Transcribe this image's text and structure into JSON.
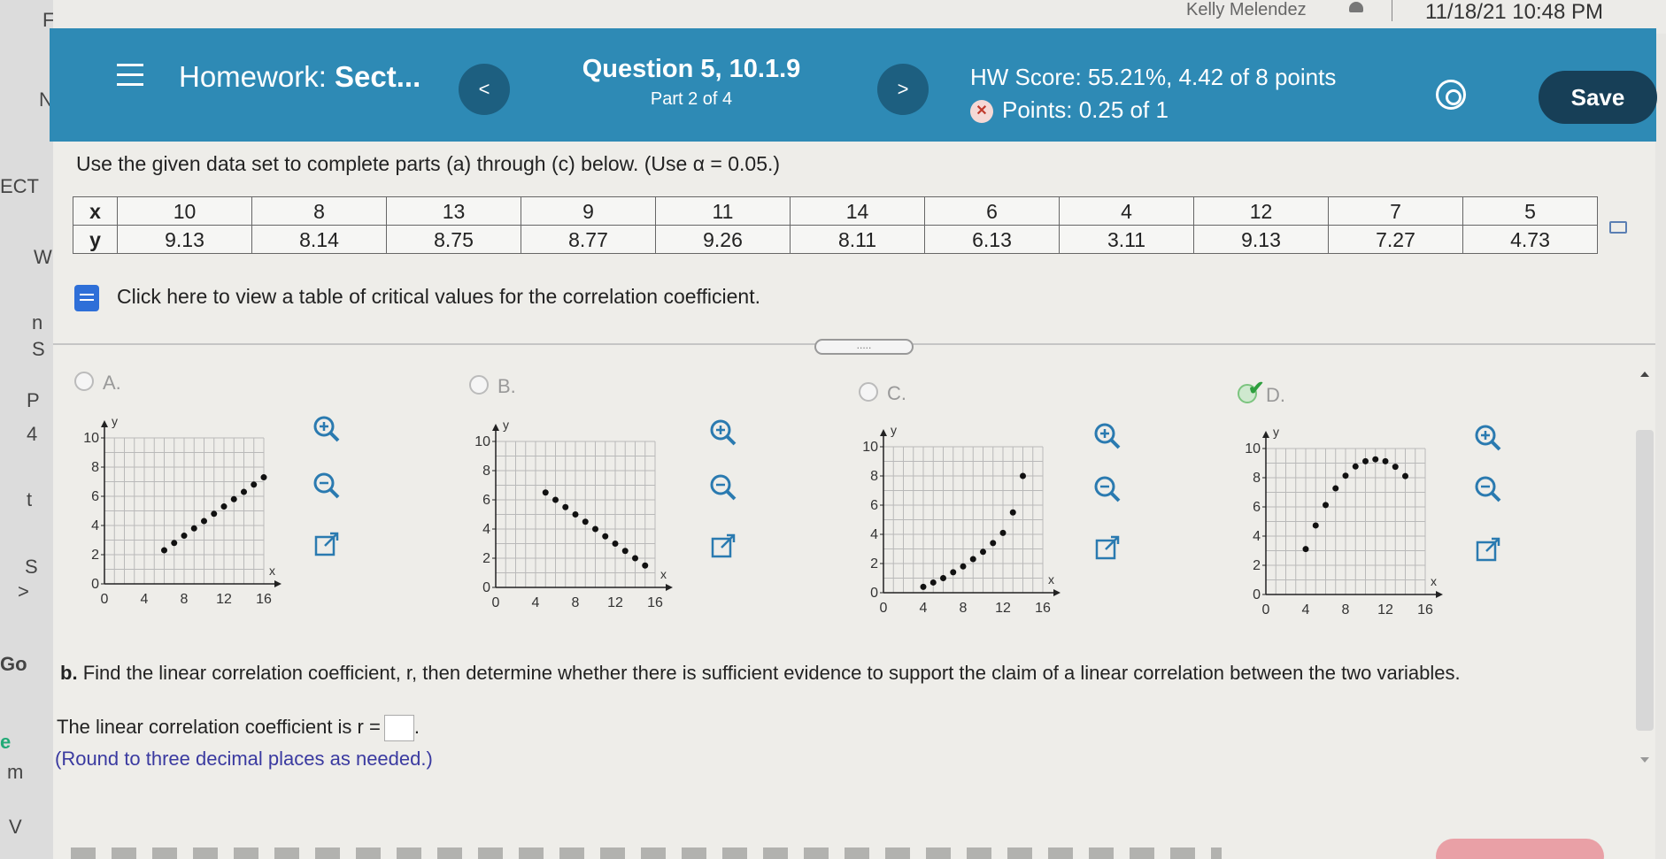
{
  "status_bar": {
    "user": "Kelly Melendez",
    "datetime": "11/18/21 10:48 PM"
  },
  "left_fragments": [
    "F",
    "N",
    "ECT",
    "W",
    "n",
    "S",
    "P",
    "4",
    "t",
    "S",
    ">",
    "Go",
    "e",
    "m",
    "V"
  ],
  "header": {
    "title_prefix": "Homework:",
    "title_section": "Sect...",
    "question": "Question 5, 10.1.9",
    "part": "Part 2 of 4",
    "hw_score": "HW Score: 55.21%, 4.42 of 8 points",
    "points": "Points: 0.25 of 1",
    "save_label": "Save",
    "prev_icon": "<",
    "next_icon": ">"
  },
  "instructions": "Use the given data set to complete parts (a) through (c) below. (Use α = 0.05.)",
  "data_table": {
    "x_label": "x",
    "y_label": "y",
    "x": [
      "10",
      "8",
      "13",
      "9",
      "11",
      "14",
      "6",
      "4",
      "12",
      "7",
      "5"
    ],
    "y": [
      "9.13",
      "8.14",
      "8.75",
      "8.77",
      "9.26",
      "8.11",
      "6.13",
      "3.11",
      "9.13",
      "7.27",
      "4.73"
    ]
  },
  "critical_values_link": "Click here to view a table of critical values for the correlation coefficient.",
  "divider_handle": ".....",
  "options": [
    {
      "label": "A.",
      "selected": false
    },
    {
      "label": "B.",
      "selected": false
    },
    {
      "label": "C.",
      "selected": false
    },
    {
      "label": "D.",
      "selected": true
    }
  ],
  "plot_axes": {
    "x_label": "x",
    "y_label": "y",
    "x_ticks": [
      "0",
      "4",
      "8",
      "12",
      "16"
    ],
    "y_ticks": [
      "0",
      "2",
      "4",
      "6",
      "8",
      "10"
    ]
  },
  "chart_data": [
    {
      "type": "scatter",
      "title": "A.",
      "xlim": [
        0,
        16
      ],
      "ylim": [
        0,
        10
      ],
      "xlabel": "x",
      "ylabel": "y",
      "x": [
        6,
        7,
        8,
        9,
        10,
        11,
        12,
        13,
        14,
        15,
        16
      ],
      "y": [
        2.3,
        2.8,
        3.3,
        3.8,
        4.3,
        4.8,
        5.3,
        5.8,
        6.3,
        6.8,
        7.3
      ]
    },
    {
      "type": "scatter",
      "title": "B.",
      "xlim": [
        0,
        16
      ],
      "ylim": [
        0,
        10
      ],
      "xlabel": "x",
      "ylabel": "y",
      "x": [
        5,
        6,
        7,
        8,
        9,
        10,
        11,
        12,
        13,
        14,
        15
      ],
      "y": [
        6.5,
        6.0,
        5.5,
        5.0,
        4.5,
        4.0,
        3.5,
        3.0,
        2.5,
        2.0,
        1.5
      ]
    },
    {
      "type": "scatter",
      "title": "C.",
      "xlim": [
        0,
        16
      ],
      "ylim": [
        0,
        10
      ],
      "xlabel": "x",
      "ylabel": "y",
      "x": [
        4,
        5,
        6,
        7,
        8,
        9,
        10,
        11,
        12,
        13,
        14
      ],
      "y": [
        0.4,
        0.7,
        1.0,
        1.4,
        1.8,
        2.3,
        2.8,
        3.4,
        4.1,
        5.5,
        8.0
      ]
    },
    {
      "type": "scatter",
      "title": "D.",
      "xlim": [
        0,
        16
      ],
      "ylim": [
        0,
        10
      ],
      "xlabel": "x",
      "ylabel": "y",
      "x": [
        4,
        5,
        6,
        7,
        8,
        9,
        10,
        11,
        12,
        13,
        14
      ],
      "y": [
        3.11,
        4.73,
        6.13,
        7.27,
        8.14,
        8.77,
        9.13,
        9.26,
        9.13,
        8.75,
        8.11
      ]
    }
  ],
  "part_b": {
    "label": "b.",
    "text": "Find the linear correlation coefficient, r, then determine whether there is sufficient evidence to support the claim of a linear correlation between the two variables.",
    "answer_prefix": "The linear correlation coefficient is r =",
    "answer_suffix": ".",
    "round_note": "(Round to three decimal places as needed.)"
  },
  "colors": {
    "header": "#2e8ab5",
    "save": "#173f57",
    "check": "#2e9e3e",
    "link_icon": "#2e6fd8",
    "zoom": "#2a7ab0"
  },
  "icons": [
    "menu-icon",
    "chevron-left-icon",
    "chevron-right-icon",
    "gear-icon",
    "book-icon",
    "zoom-in-icon",
    "zoom-out-icon",
    "external-link-icon",
    "checkmark-icon",
    "user-icon",
    "copy-icon"
  ]
}
